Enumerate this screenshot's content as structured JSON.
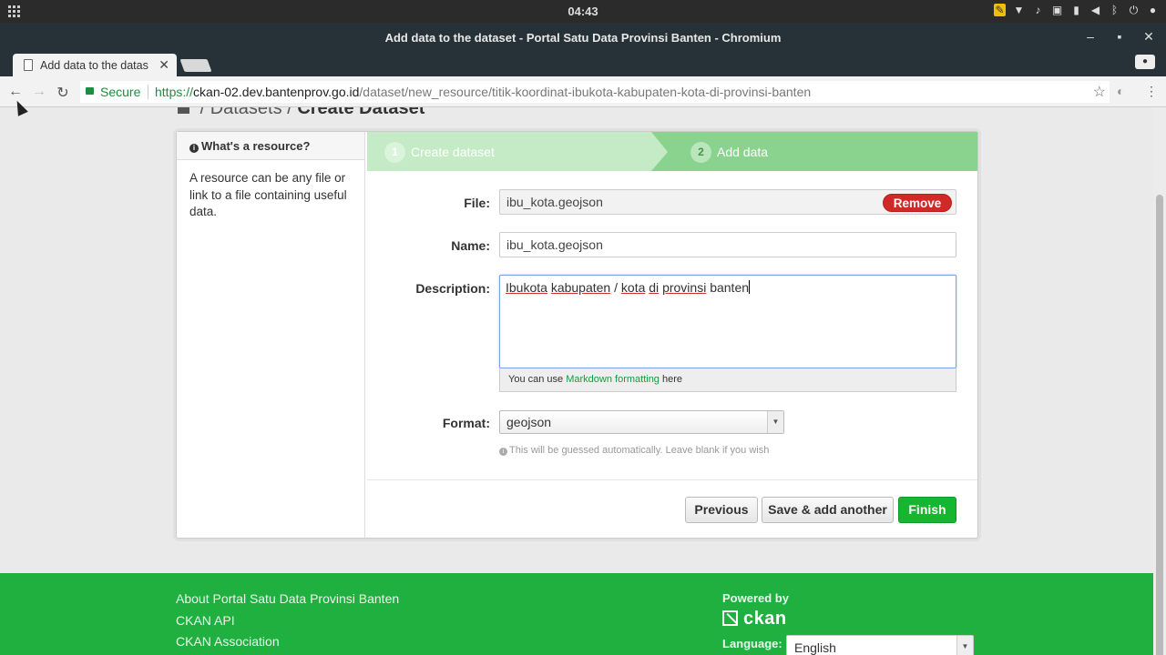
{
  "system": {
    "clock": "04:43"
  },
  "window": {
    "title": "Add data to the dataset - Portal Satu Data Provinsi Banten - Chromium"
  },
  "browser": {
    "tab_title": "Add data to the datas",
    "secure_label": "Secure",
    "url_scheme": "https://",
    "url_host": "ckan-02.dev.bantenprov.go.id",
    "url_path": "/dataset/new_resource/titik-koordinat-ibukota-kabupaten-kota-di-provinsi-banten"
  },
  "breadcrumb": {
    "sep": "/",
    "datasets": "Datasets",
    "current": "Create Dataset"
  },
  "aside": {
    "heading": "What's a resource?",
    "text": "A resource can be any file or link to a file containing useful data."
  },
  "stages": {
    "step1_num": "1",
    "step1_label": "Create dataset",
    "step2_num": "2",
    "step2_label": "Add data"
  },
  "form": {
    "file_label": "File:",
    "file_value": "ibu_kota.geojson",
    "remove_label": "Remove",
    "name_label": "Name:",
    "name_value": "ibu_kota.geojson",
    "description_label": "Description:",
    "description_words": [
      "Ibukota",
      "kabupaten",
      "/",
      "kota",
      "di",
      "provinsi",
      "banten"
    ],
    "markdown_prefix": "You can use",
    "markdown_link": "Markdown formatting",
    "markdown_suffix": "here",
    "format_label": "Format:",
    "format_value": "geojson",
    "format_hint": "This will be guessed automatically. Leave blank if you wish"
  },
  "actions": {
    "previous": "Previous",
    "save_add": "Save & add another",
    "finish": "Finish"
  },
  "footer": {
    "links": [
      "About Portal Satu Data Provinsi Banten",
      "CKAN API",
      "CKAN Association"
    ],
    "powered_by": "Powered by",
    "ckan": "ckan",
    "language_label": "Language:",
    "language_value": "English"
  }
}
